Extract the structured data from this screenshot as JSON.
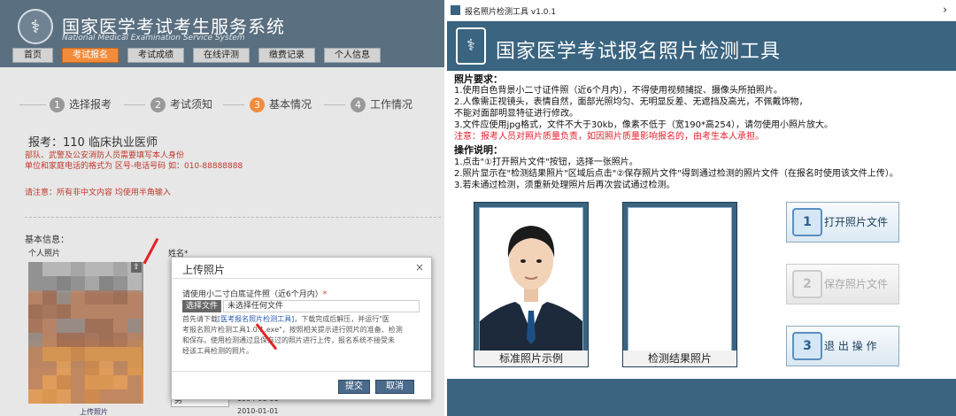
{
  "left": {
    "title": "国家医学考试考生服务系统",
    "subtitle": "National Medical Examination Service System",
    "nav": [
      "首页",
      "考试报名",
      "考试成绩",
      "在线评测",
      "缴费记录",
      "个人信息"
    ],
    "steps": [
      {
        "num": "1",
        "label": "选择报考"
      },
      {
        "num": "2",
        "label": "考试须知"
      },
      {
        "num": "3",
        "label": "基本情况"
      },
      {
        "num": "4",
        "label": "工作情况"
      }
    ],
    "exam": "报考：110 临床执业医师",
    "notice1": "部队、武警及公安消防人员需要填写本人身份",
    "notice2": "单位和家庭电话的格式为 区号-电话号码 如：010-88888888",
    "notice3": "请注意：所有非中文内容 均使用半角输入",
    "basic": "基本信息：",
    "photo_label": "个人照片",
    "name_label": "姓名*",
    "date1": "1994-01-01",
    "date2": "2010-01-01",
    "select_val": "男",
    "upload_link": "上传照片",
    "dialog": {
      "title": "上传照片",
      "close": "×",
      "req": "请使用小二寸白底证件照（近6个月内）",
      "star": "*",
      "choose": "选择文件",
      "nofile": "未选择任何文件",
      "desc1": "首先请下载",
      "desc_link": "[医考报名照片检测工具]",
      "desc2": "，下载完成后解压，并运行\"医",
      "desc3": "考报名照片检测工具1.0.1.exe\"，按照相关提示进行照片的准备、检测",
      "desc4": "和保存。使用检测通过且保存过的照片进行上传，报名系统不接受未",
      "desc5": "经该工具检测的照片。",
      "submit": "提交",
      "cancel": "取消"
    }
  },
  "right": {
    "window_title": "报名照片检测工具 v1.0.1",
    "close": "›",
    "header": "国家医学考试报名照片检测工具",
    "req_title": "照片要求：",
    "req1": "1.使用白色背景小二寸证件照（近6个月内），不得使用视频捕捉、摄像头所拍照片。",
    "req2": "2.人像需正视镜头，表情自然，面部光照均匀、无明显反差、无遮挡及高光，不佩戴饰物，",
    "req2b": "不能对面部明显特征进行修改。",
    "req3": "3.文件应使用jpg格式，文件不大于30kb，像素不低于（宽190*高254），请勿使用小照片放大。",
    "warn": "注意：报考人员对照片质量负责，如因照片质量影响报名的，由考生本人承担。",
    "ops_title": "操作说明：",
    "op1": "1.点击\"①打开照片文件\"按钮，选择一张照片。",
    "op2": "2.照片显示在\"检测结果照片\"区域后点击\"②保存照片文件\"得到通过检测的照片文件（在报名时使用该文件上传）。",
    "op3": "3.若未通过检测，须重新处理照片后再次尝试通过检测。",
    "sample_label": "标准照片示例",
    "result_label": "检测结果照片",
    "btn_open": "打开照片文件",
    "btn_save": "保存照片文件",
    "btn_exit": "退 出 操 作",
    "icon1": "1",
    "icon2": "2",
    "icon3": "3"
  },
  "colors": {
    "header_blue": "#3a6480",
    "orange": "#f28c3b",
    "warn_red": "#e3202d"
  }
}
